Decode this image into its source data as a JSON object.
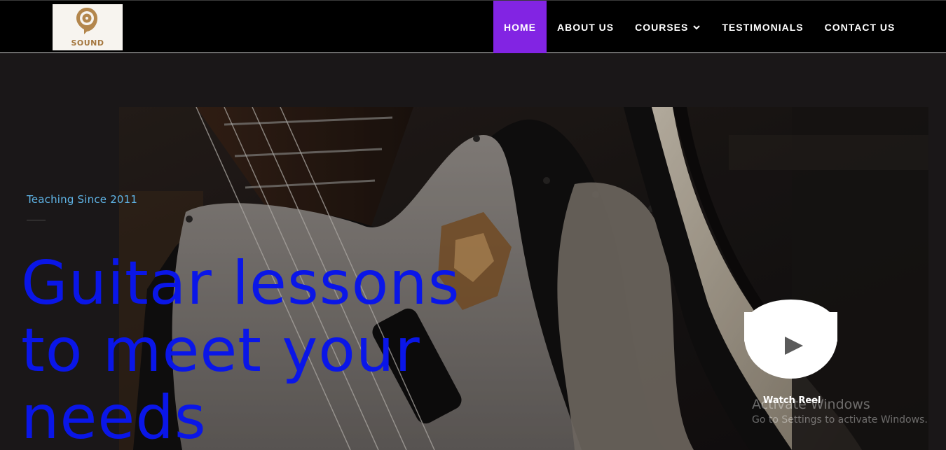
{
  "logo": {
    "text": "SOUND"
  },
  "nav": {
    "items": [
      {
        "label": "HOME",
        "active": true
      },
      {
        "label": "ABOUT US",
        "active": false
      },
      {
        "label": "COURSES",
        "active": false,
        "has_dropdown": true
      },
      {
        "label": "TESTIMONIALS",
        "active": false
      },
      {
        "label": "CONTACT US",
        "active": false
      }
    ]
  },
  "hero": {
    "eyebrow": "Teaching Since 2011",
    "headline_line1": "Guitar lessons",
    "headline_line2": "to meet your",
    "headline_line3": "needs",
    "watch_label": "Watch Reel"
  },
  "watermark": {
    "title": "Activate Windows",
    "subtitle": "Go to Settings to activate Windows."
  },
  "colors": {
    "nav_active": "#8224e3",
    "headline": "#0a16e8",
    "eyebrow": "#5fb4e6",
    "logo_brand": "#a5773e"
  }
}
